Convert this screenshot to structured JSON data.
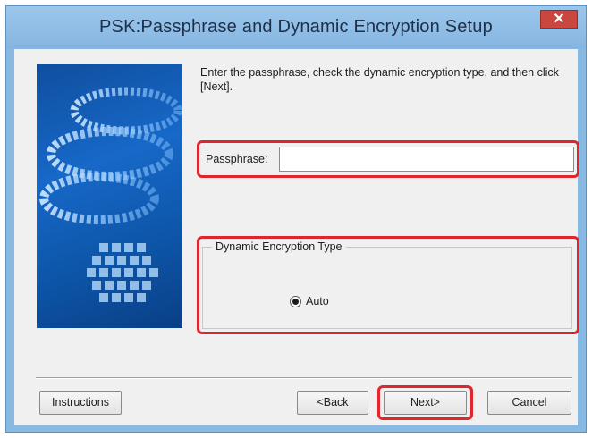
{
  "window": {
    "title": "PSK:Passphrase and Dynamic Encryption Setup",
    "close_symbol": "✕"
  },
  "prompt": "Enter the passphrase, check the dynamic encryption type, and then click [Next].",
  "passphrase": {
    "label": "Passphrase:",
    "value": "",
    "placeholder": ""
  },
  "encryption": {
    "group_label": "Dynamic Encryption Type",
    "options": [
      {
        "label": "Auto",
        "selected": true
      }
    ]
  },
  "buttons": {
    "instructions": "Instructions",
    "back": "<Back",
    "next": "Next>",
    "cancel": "Cancel"
  },
  "colors": {
    "title_bar": "#87b9e3",
    "highlight_red": "#e0262b",
    "close_button": "#c9473e",
    "dialog_background": "#f0f0f0"
  },
  "icons": [
    "close-icon",
    "radio-selected-icon",
    "network-graphic"
  ]
}
